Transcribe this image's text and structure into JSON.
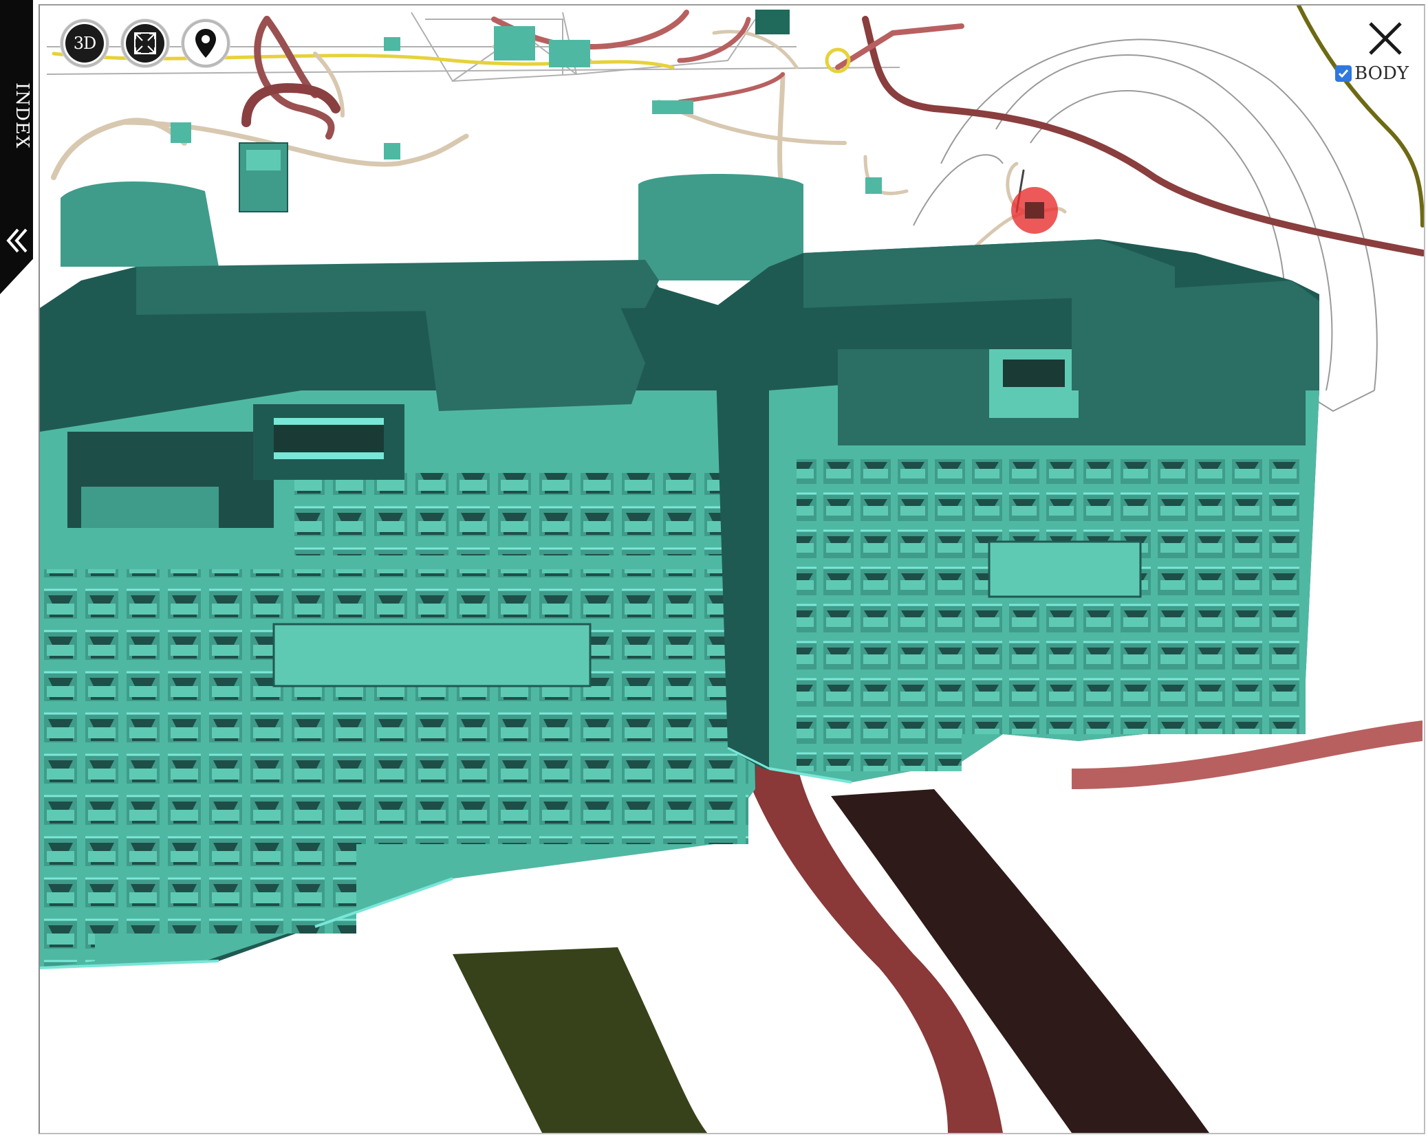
{
  "sidebar": {
    "index_label": "INDEX",
    "collapse_icon": "double-chevron-left-icon"
  },
  "toolbar": {
    "view_3d_label": "3D",
    "fullscreen_icon": "fullscreen-expand-icon",
    "locate_icon": "map-pin-icon"
  },
  "viewer": {
    "close_icon": "close-x-icon",
    "body_toggle": {
      "label": "BODY",
      "checked": true
    }
  },
  "colors": {
    "connector": "#4fb8a3",
    "connector_shadow": "#1f5a52",
    "connector_highlight": "#79e6d8",
    "harness_red": "#b86060",
    "harness_dark": "#2e1a18",
    "harness_olive": "#37421a",
    "harness_yellow": "#e6d23a",
    "harness_beige": "#d8c8b0",
    "marker": "#e83030",
    "checkbox": "#2f78e0"
  }
}
